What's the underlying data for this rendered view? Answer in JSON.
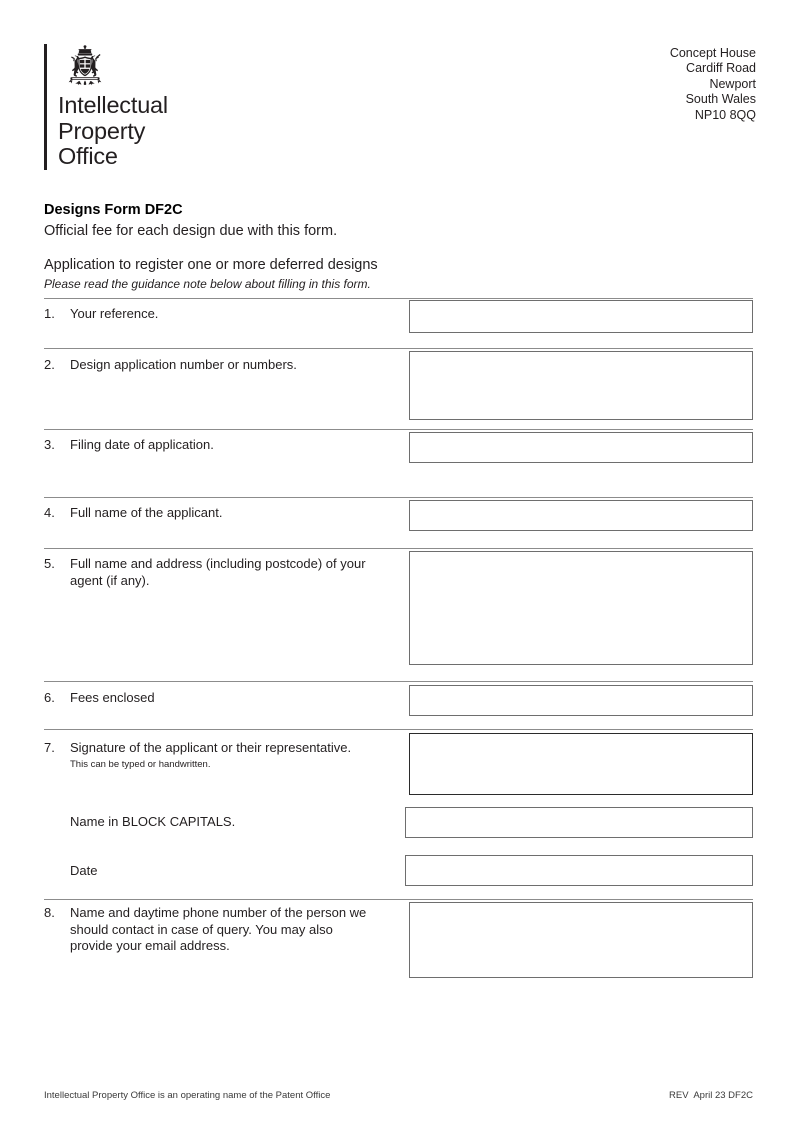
{
  "header": {
    "logo_lines": [
      "Intellectual",
      "Property",
      "Office"
    ],
    "crest_name": "royal-coat-of-arms-crest",
    "address": [
      "Concept House",
      "Cardiff Road",
      "Newport",
      "South Wales",
      "NP10 8QQ"
    ]
  },
  "title": {
    "form_code": "Designs Form DF2C",
    "fee_note": "Official fee for each design due with this form.",
    "subject": "Application to register one or more deferred designs",
    "guidance": "Please read the guidance note below about filling in this form."
  },
  "questions": [
    {
      "number": "1.",
      "label": "Your reference.",
      "sublabel": "",
      "value": "",
      "placeholder": ""
    },
    {
      "number": "2.",
      "label": "Design application number or numbers.",
      "sublabel": "",
      "value": "",
      "placeholder": ""
    },
    {
      "number": "3.",
      "label": "Filing date of application.",
      "sublabel": "",
      "value": "",
      "placeholder": ""
    },
    {
      "number": "4.",
      "label": "Full name of the applicant.",
      "sublabel": "",
      "value": "",
      "placeholder": ""
    },
    {
      "number": "5.",
      "label": "Full name and address (including postcode) of your agent (if any).",
      "sublabel": "",
      "value": "",
      "placeholder": ""
    },
    {
      "number": "6.",
      "label": "Fees enclosed",
      "sublabel": "",
      "value": "",
      "placeholder": ""
    },
    {
      "number": "7.",
      "label": "Signature of the applicant or their representative.",
      "sublabel": "This can be typed or handwritten.",
      "value": "",
      "placeholder": ""
    },
    {
      "number": "",
      "label": "Name in BLOCK CAPITALS.",
      "sublabel": "",
      "value": "",
      "placeholder": ""
    },
    {
      "number": "",
      "label": "Date",
      "sublabel": "",
      "value": "",
      "placeholder": ""
    },
    {
      "number": "8.",
      "label": "Name and daytime phone number of the person we should contact in case of query. You may also provide your email address.",
      "sublabel": "",
      "value": "",
      "placeholder": ""
    }
  ],
  "footer": {
    "operating_name": "Intellectual Property Office is an operating name of the Patent Office",
    "revision": "REV  April 23 DF2C"
  }
}
